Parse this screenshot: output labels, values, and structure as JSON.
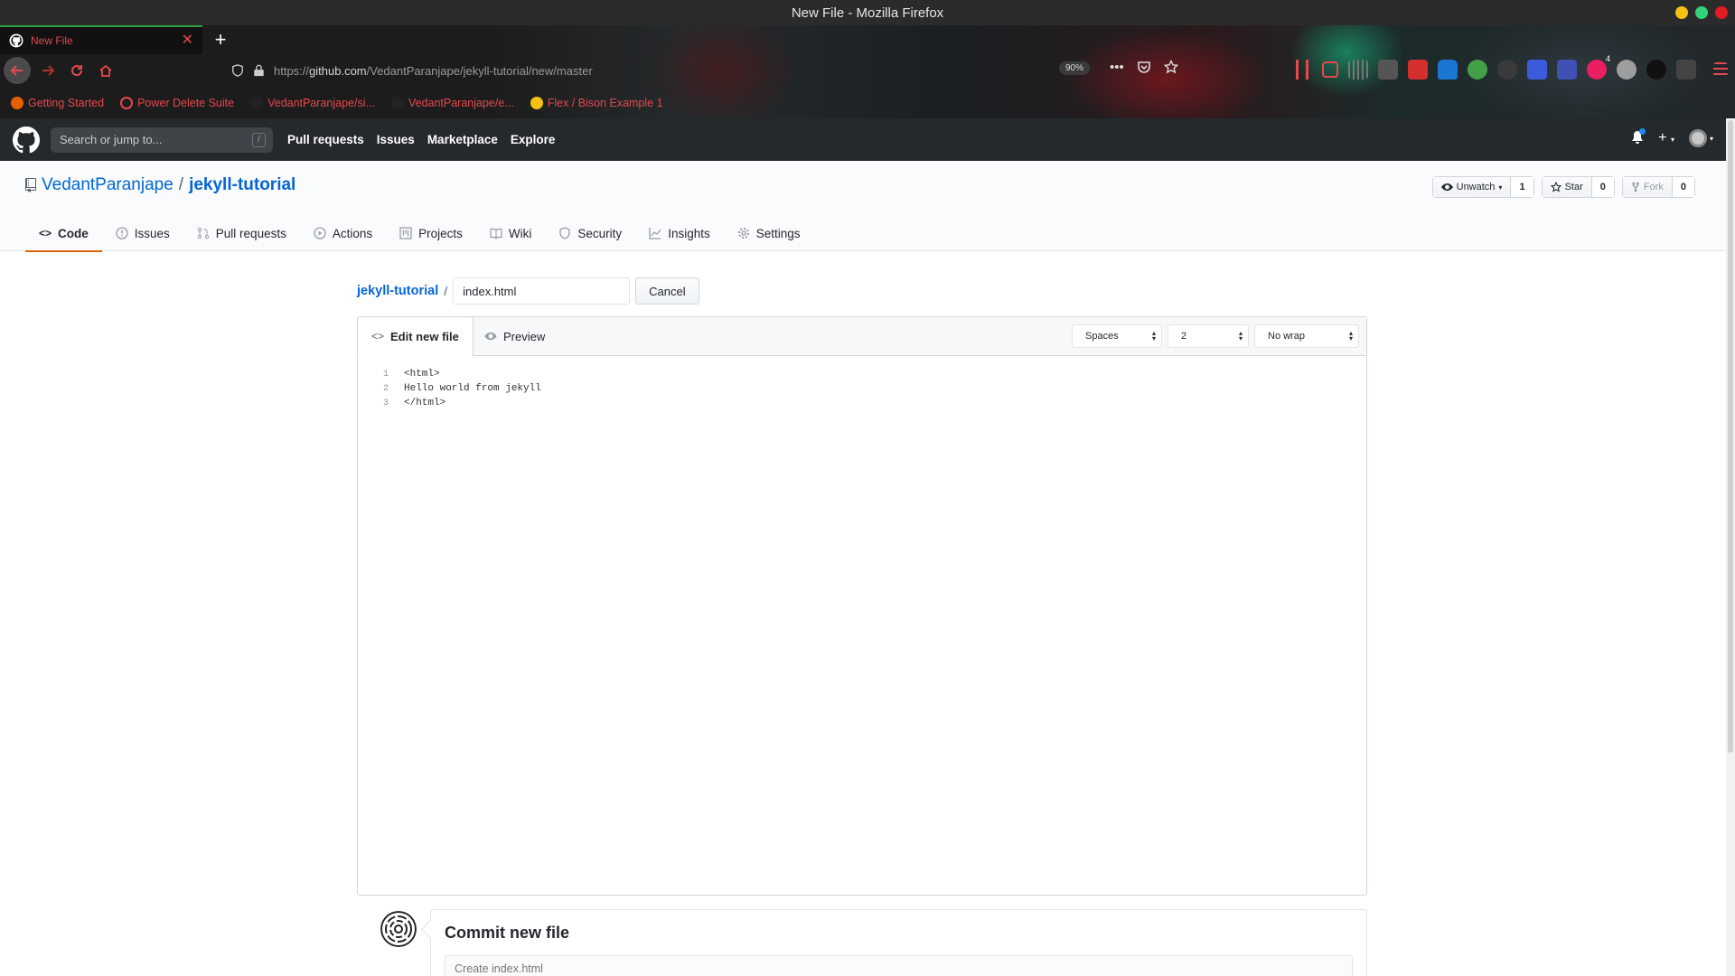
{
  "window": {
    "title": "New File - Mozilla Firefox",
    "buttons": [
      {
        "name": "minimize",
        "color": "#f5c211"
      },
      {
        "name": "maximize",
        "color": "#33d17a"
      },
      {
        "name": "close",
        "color": "#e01b24"
      }
    ]
  },
  "browser": {
    "tab": {
      "title": "New File",
      "favicon": "github-icon",
      "close_icon": "close-icon"
    },
    "new_tab_icon": "plus-icon",
    "url": {
      "prefix": "https://",
      "host": "github.com",
      "path": "/VedantParanjape/jekyll-tutorial/new/master"
    },
    "zoom": "90%",
    "bookmarks": [
      {
        "label": "Getting Started",
        "icon": "firefox-icon",
        "color": "#e66000"
      },
      {
        "label": "Power Delete Suite",
        "icon": "globe-icon",
        "color": "#e5484d"
      },
      {
        "label": "VedantParanjape/si...",
        "icon": "github-icon",
        "color": "#222222"
      },
      {
        "label": "VedantParanjape/e...",
        "icon": "github-icon",
        "color": "#222222"
      },
      {
        "label": "Flex / Bison Example 1",
        "icon": "bulb-icon",
        "color": "#f5c211"
      }
    ],
    "toolbar_icons": [
      {
        "name": "library-icon",
        "color": "#e5484d"
      },
      {
        "name": "sidebar-icon",
        "color": "#e5484d"
      },
      {
        "name": "reader-icon",
        "color": "#555555"
      },
      {
        "name": "extension-toggle-icon",
        "color": "#cccccc"
      },
      {
        "name": "pdf-icon",
        "color": "#d32f2f"
      },
      {
        "name": "password-icon",
        "color": "#1976d2"
      },
      {
        "name": "sync-icon",
        "color": "#43a047"
      },
      {
        "name": "spy-icon",
        "color": "#333333"
      },
      {
        "name": "translate-icon",
        "color": "#3b5bdb"
      },
      {
        "name": "formula-icon",
        "color": "#3f51b5"
      },
      {
        "name": "notification-icon",
        "color": "#e91e63",
        "badge": "4"
      },
      {
        "name": "globe-icon",
        "color": "#9e9e9e"
      },
      {
        "name": "medium-icon",
        "color": "#111111"
      },
      {
        "name": "arrow-icon",
        "color": "#444444"
      },
      {
        "name": "menu-icon",
        "color": "#e5484d"
      }
    ]
  },
  "github": {
    "search_placeholder": "Search or jump to...",
    "slash_hint": "/",
    "nav": [
      "Pull requests",
      "Issues",
      "Marketplace",
      "Explore"
    ]
  },
  "repo": {
    "owner": "VedantParanjape",
    "separator": "/",
    "name": "jekyll-tutorial",
    "actions": [
      {
        "label": "Unwatch",
        "count": "1",
        "icon": "eye-icon",
        "dropdown": true,
        "disabled": false
      },
      {
        "label": "Star",
        "count": "0",
        "icon": "star-icon",
        "dropdown": false,
        "disabled": false
      },
      {
        "label": "Fork",
        "count": "0",
        "icon": "fork-icon",
        "dropdown": false,
        "disabled": true
      }
    ],
    "tabs": [
      {
        "label": "Code",
        "icon": "code-icon",
        "selected": true
      },
      {
        "label": "Issues",
        "icon": "issue-icon",
        "selected": false
      },
      {
        "label": "Pull requests",
        "icon": "pull-request-icon",
        "selected": false
      },
      {
        "label": "Actions",
        "icon": "play-icon",
        "selected": false
      },
      {
        "label": "Projects",
        "icon": "project-icon",
        "selected": false
      },
      {
        "label": "Wiki",
        "icon": "book-icon",
        "selected": false
      },
      {
        "label": "Security",
        "icon": "shield-icon",
        "selected": false
      },
      {
        "label": "Insights",
        "icon": "graph-icon",
        "selected": false
      },
      {
        "label": "Settings",
        "icon": "gear-icon",
        "selected": false
      }
    ]
  },
  "editor": {
    "breadcrumb_root": "jekyll-tutorial",
    "breadcrumb_sep": "/",
    "filename": "index.html",
    "cancel_label": "Cancel",
    "edit_tab": "Edit new file",
    "preview_tab": "Preview",
    "indent_mode": "Spaces",
    "indent_size": "2",
    "wrap_mode": "No wrap",
    "lines": [
      {
        "n": "1",
        "text": "<html>"
      },
      {
        "n": "2",
        "text": "Hello world from jekyll"
      },
      {
        "n": "3",
        "text": "</html>"
      }
    ]
  },
  "commit": {
    "title": "Commit new file",
    "placeholder": "Create index.html"
  }
}
